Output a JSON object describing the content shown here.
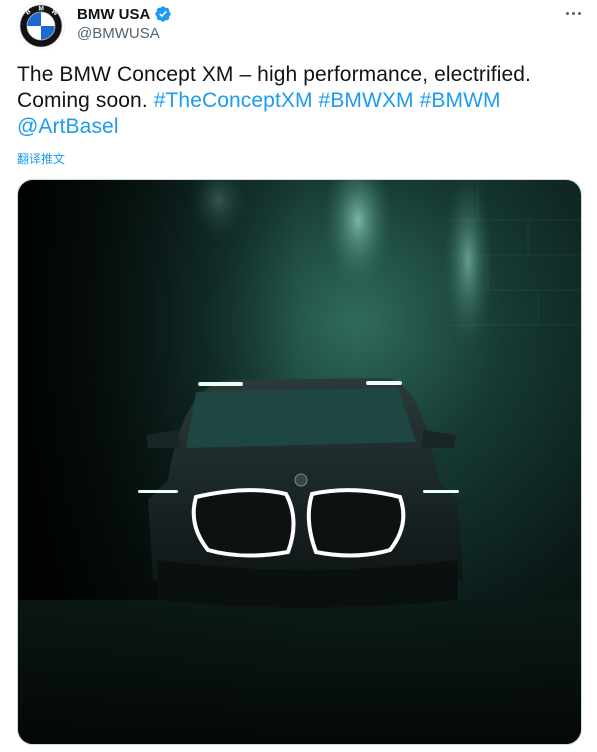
{
  "author": {
    "display_name": "BMW USA",
    "handle": "@BMWUSA",
    "avatar_icon": "bmw-roundel-logo",
    "verified_icon": "verified-badge-icon",
    "logo_text": "BMW"
  },
  "tweet": {
    "text_plain": "The BMW Concept XM – high performance, electrified. Coming soon.",
    "hashtags": [
      "#TheConceptXM",
      "#BMWXM",
      "#BMWM"
    ],
    "mention": "@ArtBasel",
    "translate_label": "翻译推文"
  },
  "menu": {
    "more_icon": "more-options-icon"
  },
  "media": {
    "subject": "photo-bmw-concept-xm-illuminated-grille"
  },
  "colors": {
    "link": "#1d9bf0",
    "text": "#0f1419",
    "secondary": "#536471",
    "verified": "#1d9bf0",
    "bmw_blue": "#1c69d4"
  }
}
